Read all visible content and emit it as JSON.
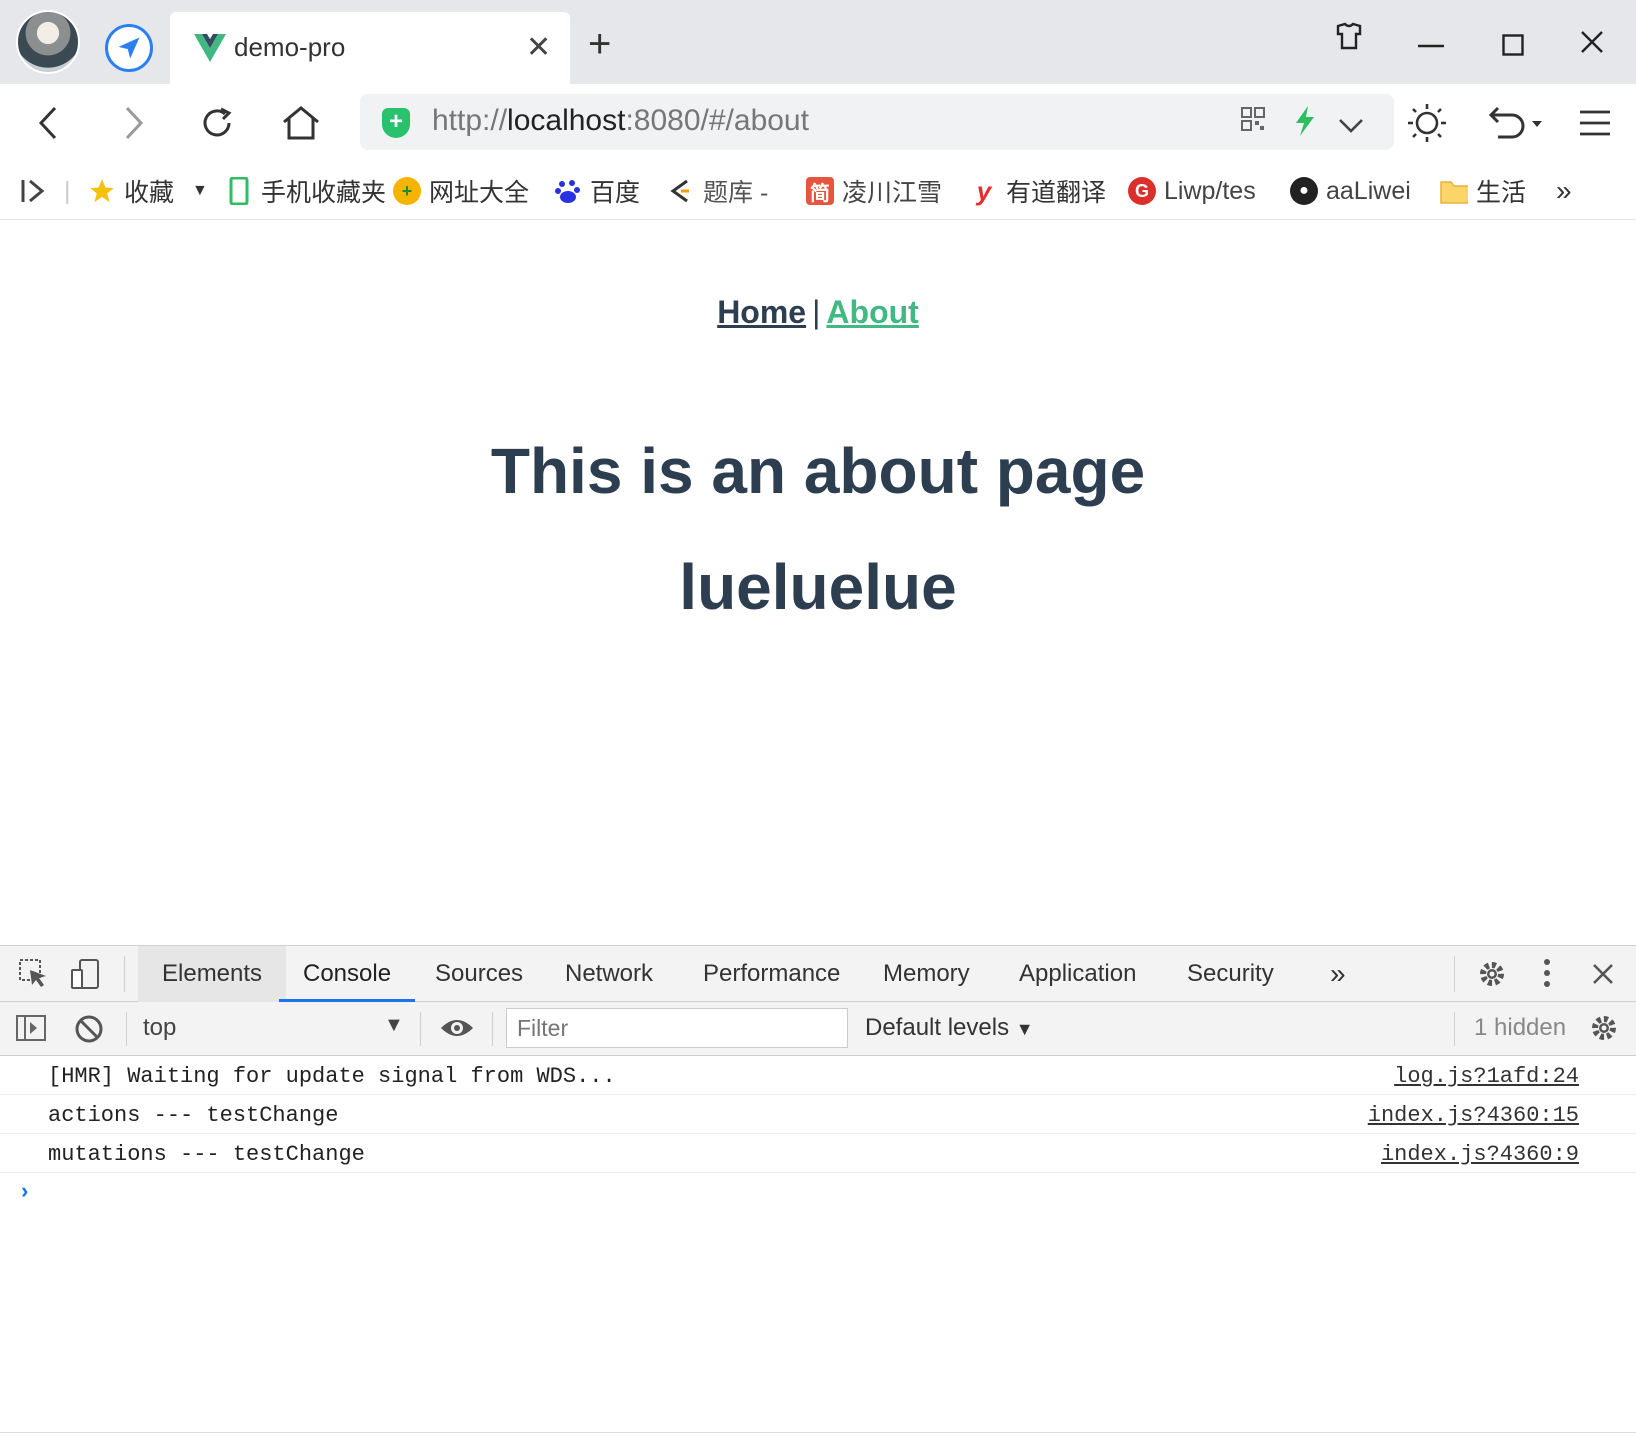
{
  "browser": {
    "tab_title": "demo-pro",
    "url_scheme": "http://",
    "url_host": "localhost",
    "url_rest": ":8080/#/about"
  },
  "bookmarks": [
    {
      "label": "收藏",
      "icon": "star-icon",
      "color": "#f4c20d"
    },
    {
      "label": "手机收藏夹",
      "icon": "phone-icon",
      "color": "#2dbe60"
    },
    {
      "label": "网址大全",
      "icon": "plus-circle-icon",
      "color": "#f6b400"
    },
    {
      "label": "百度",
      "icon": "paw-icon",
      "color": "#2932e1"
    },
    {
      "label": "题库 -",
      "icon": "c-logo-icon",
      "color": "#333333"
    },
    {
      "label": "凌川江雪",
      "icon": "jian-icon",
      "color": "#e8553f"
    },
    {
      "label": "有道翻译",
      "icon": "youdao-icon",
      "color": "#e82d2d"
    },
    {
      "label": "Liwp/tes",
      "icon": "gitee-icon",
      "color": "#d9302c"
    },
    {
      "label": "aaLiwei",
      "icon": "github-icon",
      "color": "#222222"
    },
    {
      "label": "生活",
      "icon": "folder-icon",
      "color": "#f5c342"
    }
  ],
  "more_bookmarks": "»",
  "page": {
    "nav_home": "Home",
    "nav_sep": "|",
    "nav_about": "About",
    "heading": "This is an about page",
    "subheading": "lueluelue"
  },
  "devtools": {
    "tabs": [
      "Elements",
      "Console",
      "Sources",
      "Network",
      "Performance",
      "Memory",
      "Application",
      "Security"
    ],
    "more_tabs": "»",
    "context": "top",
    "filter_placeholder": "Filter",
    "levels": "Default levels",
    "hidden": "1 hidden",
    "messages": [
      {
        "text": "[HMR] Waiting for update signal from WDS...",
        "source": "log.js?1afd:24"
      },
      {
        "text": "actions --- testChange",
        "source": "index.js?4360:15"
      },
      {
        "text": "mutations --- testChange",
        "source": "index.js?4360:9"
      }
    ],
    "prompt": "›"
  },
  "colors": {
    "vue_green": "#42b983",
    "text_dark": "#2c3e50",
    "devtools_blue": "#1a73e8"
  }
}
